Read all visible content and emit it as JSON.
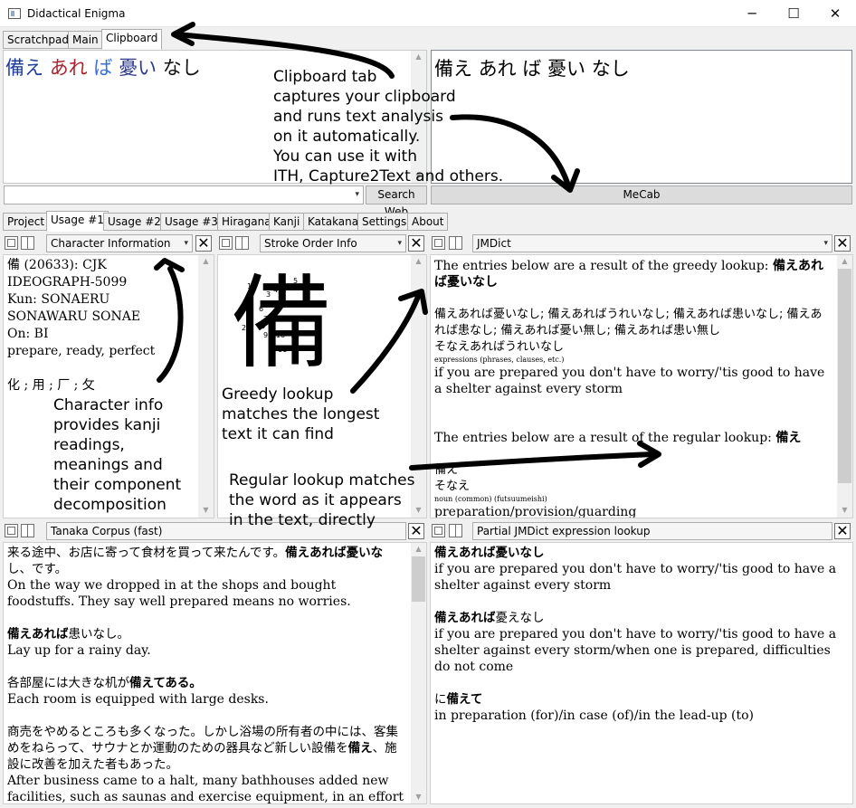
{
  "window": {
    "title": "Didactical Enigma",
    "minimize": "─",
    "maximize": "☐",
    "close": "✕"
  },
  "top_tabs": [
    "Scratchpad",
    "Main",
    "Clipboard"
  ],
  "clipboard": {
    "left_words": [
      "備え",
      "あれ",
      "ば",
      "憂い",
      "なし"
    ],
    "right_text": "備え あれ ば 憂い なし",
    "search_web": "Search Web",
    "mecab": "MeCab",
    "combo_chev": "▾"
  },
  "bottom_tabs": [
    "Project",
    "Usage #1",
    "Usage #2",
    "Usage #3",
    "Hiragana",
    "Kanji",
    "Katakana",
    "Settings",
    "About"
  ],
  "panes": {
    "char_info": {
      "title": "Character Information",
      "close": "✕",
      "lines": [
        "備 (20633): CJK",
        "IDEOGRAPH-5099",
        "Kun: SONAERU",
        "SONAWARU SONAE",
        "On: BI",
        "prepare, ready, perfect",
        "",
        "化 ; 用 ; 厂 ; 攵"
      ]
    },
    "stroke": {
      "title": "Stroke Order Info",
      "close": "✕",
      "kanji": "備",
      "numbers": [
        "1",
        "2",
        "3",
        "4",
        "5",
        "6",
        "7",
        "8",
        "9",
        "10",
        "11",
        "12"
      ]
    },
    "jmdict": {
      "title": "JMDict",
      "close": "✕",
      "greedy_intro": "The entries below are a result of the greedy lookup: ",
      "greedy_bold": "備えあれば憂いなし",
      "variants": "備えあれば憂いなし; 備えあればうれいなし; 備えあれば患いなし; 備えあれば患なし; 備えあれば憂い無し; 備えあれば患い無し",
      "kana": "そなえあればうれいなし",
      "pos1": "expressions (phrases, clauses, etc.)",
      "gloss1": "if you are prepared you don't have to worry/'tis good to have a shelter against every storm",
      "regular_intro": "The entries below are a result of the regular lookup: ",
      "regular_bold": "備え",
      "entry2": "備え",
      "kana2": "そなえ",
      "pos2": "noun (common) (futsuumeishi)",
      "gloss2": "preparation/provision/guarding"
    },
    "tanaka": {
      "title": "Tanaka Corpus (fast)",
      "close": "✕",
      "s1_pre": "来る途中、お店に寄って食材を買って来たんです。",
      "s1_bold": "備えあれば憂いな",
      "s1_post": "し、です。",
      "e1": "On the way we dropped in at the shops and bought foodstuffs. They say well prepared means no worries.",
      "s2_bold": "備えあれば",
      "s2_post": "患いなし。",
      "e2": "Lay up for a rainy day.",
      "s3_pre": "各部屋には大きな机が",
      "s3_bold": "備えてある。",
      "e3": "Each room is equipped with large desks.",
      "s4_pre": "商売をやめるところも多くなった。しかし浴場の所有者の中には、客集めをねらって、サウナとか運動のための器具など新しい設備を",
      "s4_bold": "備え",
      "s4_post": "、施設に改善を加えた者もあった。",
      "e4": "After business came to a halt, many bathhouses added new facilities, such as saunas and exercise equipment, in an effort"
    },
    "partial": {
      "title": "Partial JMDict expression lookup",
      "close": "✕",
      "h1_bold": "備えあれば憂いなし",
      "g1": "if you are prepared you don't have to worry/'tis good to have a shelter against every storm",
      "h2_bold": "備えあれば",
      "h2_post": "憂えなし",
      "g2": "if you are prepared you don't have to worry/'tis good to have a shelter against every storm/when one is prepared, difficulties do not come",
      "h3_pre": "に",
      "h3_bold": "備えて",
      "g3": "in preparation (for)/in case (of)/in the lead-up (to)"
    }
  },
  "annotations": {
    "clipboard": "Clipboard tab\ncaptures your clipboard\nand runs text analysis\non it automatically.\nYou can use it with\nITH, Capture2Text and others.",
    "charinfo": "Character info\nprovides kanji\nreadings,\nmeanings and\ntheir component\ndecomposition",
    "greedy": "Greedy lookup\nmatches the longest\ntext it can find",
    "regular": "Regular lookup matches\nthe word as it appears\nin the text, directly"
  },
  "colors": {
    "word_blue": "#1e3fa0",
    "word_red": "#a8232e",
    "word_lightblue": "#3a6fd8",
    "word_navy": "#2c3a8c",
    "word_black": "#111111"
  }
}
